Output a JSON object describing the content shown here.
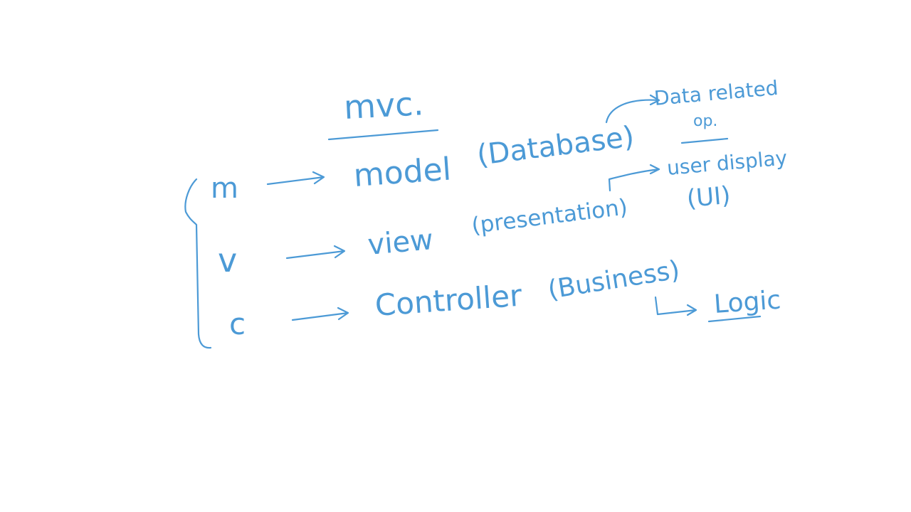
{
  "ink_color": "#4c9ad6",
  "background": "#ffffff",
  "heading": "mvc.",
  "rows": [
    {
      "letter": "m",
      "word": "model",
      "note": "(Database)"
    },
    {
      "letter": "v",
      "word": "view",
      "note": "(presentation)"
    },
    {
      "letter": "c",
      "word": "Controller",
      "note": "(Business)"
    }
  ],
  "annotations": {
    "model_detail_line1": "Data related",
    "model_detail_line2": "op.",
    "view_detail_line1": "user display",
    "view_detail_line2": "(UI)",
    "controller_detail": "Logic"
  }
}
